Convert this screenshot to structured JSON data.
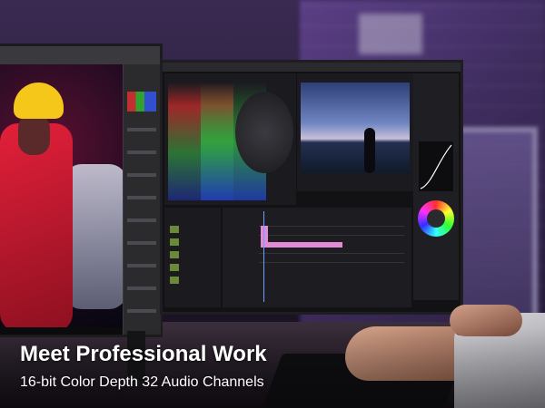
{
  "headline": "Meet Professional Work",
  "subline": "16-bit Color Depth 32 Audio Channels",
  "colors": {
    "text": "#ffffff",
    "ambient_purple": "#5b3f86",
    "timeline_clip": "#e389d6"
  }
}
